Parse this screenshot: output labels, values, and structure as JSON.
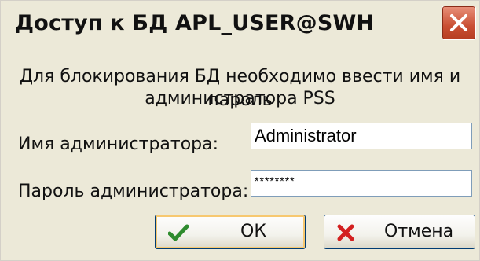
{
  "window": {
    "title": "Доступ к БД APL_USER@SWH"
  },
  "message": {
    "line1": "Для блокирования БД необходимо ввести имя и пароль",
    "line2": "администратора PSS"
  },
  "form": {
    "admin_name_label": "Имя администратора:",
    "admin_name_value": "Administrator",
    "admin_password_label": "Пароль администратора:",
    "admin_password_value": "********"
  },
  "buttons": {
    "ok_label": "ОК",
    "cancel_label": "Отмена"
  },
  "icons": {
    "close": "close-icon",
    "ok": "checkmark-icon",
    "cancel": "cross-icon"
  },
  "colors": {
    "dialog_bg": "#ece9d8",
    "close_button": "#c94f33",
    "ok_check": "#2e8b2e",
    "cancel_cross": "#d32020"
  }
}
